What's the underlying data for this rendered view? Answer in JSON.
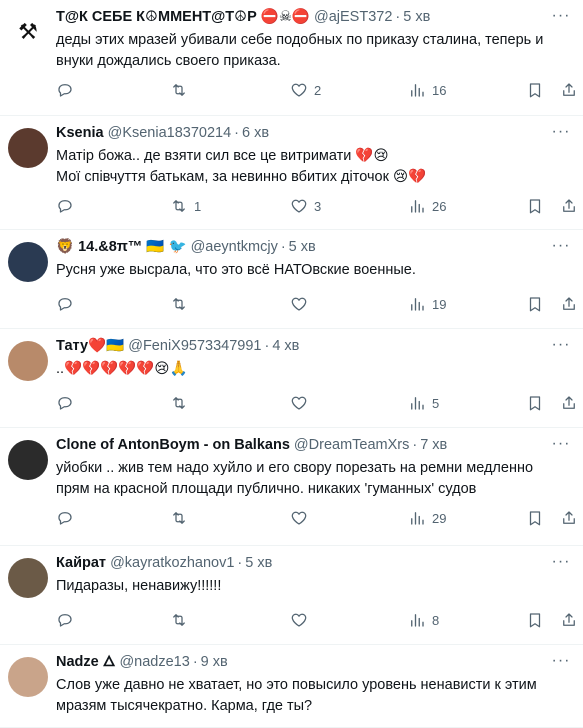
{
  "tweets": [
    {
      "name": "Т@К СЕБЕ К☮ММЕНТ@Т☮Р ⛔☠⛔",
      "handle": "@ajEST372",
      "time": "5 хв",
      "text": "деды этих мразей убивали себе подобных по приказу сталина, теперь и\nвнуки дождались своего приказа.",
      "replies": "",
      "retweets": "",
      "likes": "2",
      "views": "16"
    },
    {
      "name": "Ksenia",
      "handle": "@Ksenia18370214",
      "time": "6 хв",
      "text": "Матір божа.. де взяти сил все це витримати 💔😢\nМої співчуття батькам, за невинно вбитих діточок 😢💔",
      "replies": "",
      "retweets": "1",
      "likes": "3",
      "views": "26"
    },
    {
      "name": "🦁 14.&8π™ 🇺🇦 🐦",
      "handle": "@aeyntkmcjy",
      "time": "5 хв",
      "text": "Русня уже высрала, что это всё НАТОвские военные.",
      "replies": "",
      "retweets": "",
      "likes": "",
      "views": "19"
    },
    {
      "name": "Тату❤️🇺🇦",
      "handle": "@FeniX9573347991",
      "time": "4 хв",
      "text": "..💔💔💔💔💔😢🙏",
      "replies": "",
      "retweets": "",
      "likes": "",
      "views": "5"
    },
    {
      "name": "Clone of AntonBoym - on Balkans",
      "handle": "@DreamTeamXrs",
      "time": "7 хв",
      "text": "уйобки .. жив тем надо хуйло и его свору порезать на ремни медленно\nпрям на красной площади публично. никаких 'гуманных' судов",
      "replies": "",
      "retweets": "",
      "likes": "",
      "views": "29"
    },
    {
      "name": "Кайрат",
      "handle": "@kayratkozhanov1",
      "time": "5 хв",
      "text": "Пидаразы, ненавижу!!!!!!",
      "replies": "",
      "retweets": "",
      "likes": "",
      "views": "8"
    },
    {
      "name": "Nadze 🜂",
      "handle": "@nadze13",
      "time": "9 хв",
      "text": "Слов уже давно не хватает, но это повысило уровень ненависти к этим\nмразям тысячекратно. Карма, где ты?",
      "replies": "",
      "retweets": "",
      "likes": "",
      "views": ""
    }
  ],
  "icons": {
    "reply": "reply-icon",
    "retweet": "retweet-icon",
    "like": "like-icon",
    "views": "views-icon",
    "bookmark": "bookmark-icon",
    "share": "share-icon",
    "more": "more-icon"
  },
  "colors": {
    "text": "#0f1419",
    "muted": "#536471",
    "divider": "#eff3f4"
  }
}
